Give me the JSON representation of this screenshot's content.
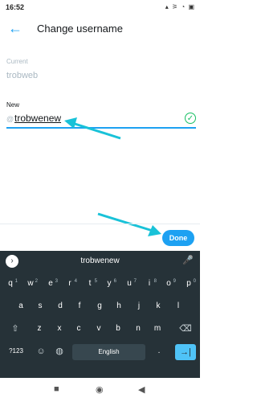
{
  "status": {
    "time": "16:52",
    "icons_text": "▴  ⚞ ◔ ▣"
  },
  "appbar": {
    "title": "Change username"
  },
  "current": {
    "label": "Current",
    "value": "trobweb"
  },
  "new": {
    "label": "New",
    "prefix": "@",
    "value": "trobwenew"
  },
  "actions": {
    "done": "Done"
  },
  "keyboard": {
    "suggestion": "trobwenew",
    "row1": [
      "q",
      "w",
      "e",
      "r",
      "t",
      "y",
      "u",
      "i",
      "o",
      "p"
    ],
    "row1_sup": [
      "1",
      "2",
      "3",
      "4",
      "5",
      "6",
      "7",
      "8",
      "9",
      "0"
    ],
    "row2": [
      "a",
      "s",
      "d",
      "f",
      "g",
      "h",
      "j",
      "k",
      "l"
    ],
    "row3": [
      "z",
      "x",
      "c",
      "v",
      "b",
      "n",
      "m"
    ],
    "symbols": "?123",
    "space": "English"
  },
  "colors": {
    "accent": "#1da1f2",
    "success": "#17bf63",
    "keyboard_bg": "#263238",
    "enter": "#4fc3f7"
  }
}
